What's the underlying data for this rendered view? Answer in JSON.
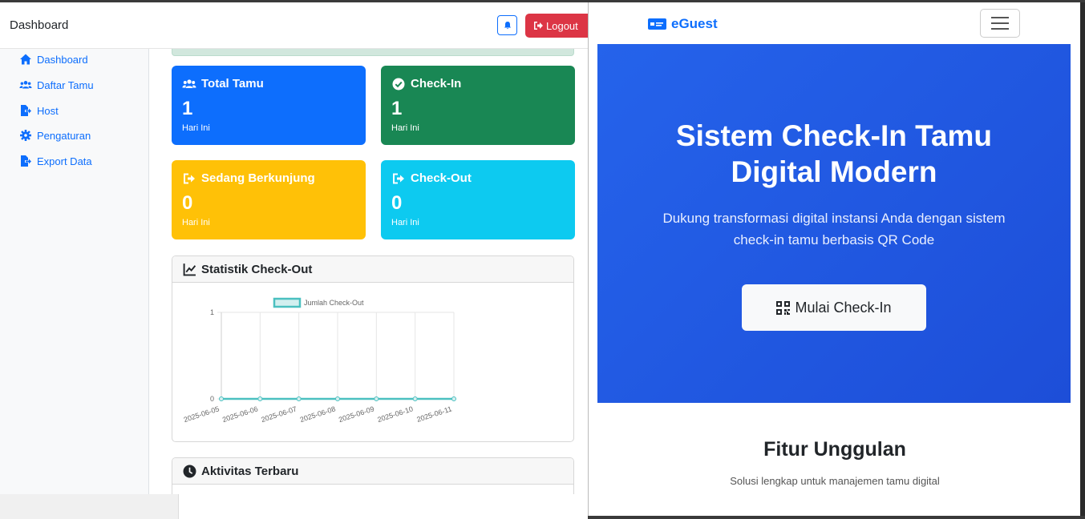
{
  "topbar": {
    "title": "Dashboard",
    "logout_label": "Logout"
  },
  "sidebar": {
    "items": [
      {
        "label": "Dashboard",
        "icon": "home-icon"
      },
      {
        "label": "Daftar Tamu",
        "icon": "users-icon"
      },
      {
        "label": "Host",
        "icon": "file-export-icon"
      },
      {
        "label": "Pengaturan",
        "icon": "gear-icon"
      },
      {
        "label": "Export Data",
        "icon": "file-export-icon"
      }
    ]
  },
  "stats": [
    {
      "title": "Total Tamu",
      "value": "1",
      "sub": "Hari Ini",
      "color": "#0d6efd",
      "icon": "users-icon"
    },
    {
      "title": "Check-In",
      "value": "1",
      "sub": "Hari Ini",
      "color": "#198754",
      "icon": "check-circle-icon"
    },
    {
      "title": "Sedang Berkunjung",
      "value": "0",
      "sub": "Hari Ini",
      "color": "#ffc107",
      "icon": "sign-out-icon"
    },
    {
      "title": "Check-Out",
      "value": "0",
      "sub": "Hari Ini",
      "color": "#0dcaf0",
      "icon": "sign-out-icon"
    }
  ],
  "chart_card": {
    "title": "Statistik Check-Out"
  },
  "activity_card": {
    "title": "Aktivitas Terbaru"
  },
  "chart_data": {
    "type": "line",
    "categories": [
      "2025-06-05",
      "2025-06-06",
      "2025-06-07",
      "2025-06-08",
      "2025-06-09",
      "2025-06-10",
      "2025-06-11"
    ],
    "series": [
      {
        "name": "Jumlah Check-Out",
        "values": [
          0,
          0,
          0,
          0,
          0,
          0,
          0
        ],
        "color": "#4bc0c0"
      }
    ],
    "ylim": [
      0,
      1
    ],
    "yticks": [
      "0",
      "1"
    ],
    "title": "",
    "xlabel": "",
    "ylabel": "",
    "legend": "top",
    "grid": true
  },
  "eguest": {
    "brand": "eGuest",
    "hero_title_line1": "Sistem Check-In Tamu",
    "hero_title_line2": "Digital Modern",
    "hero_sub": "Dukung transformasi digital instansi Anda dengan sistem check-in tamu berbasis QR Code",
    "hero_button": "Mulai Check-In",
    "features_title": "Fitur Unggulan",
    "features_sub": "Solusi lengkap untuk manajemen tamu digital"
  }
}
